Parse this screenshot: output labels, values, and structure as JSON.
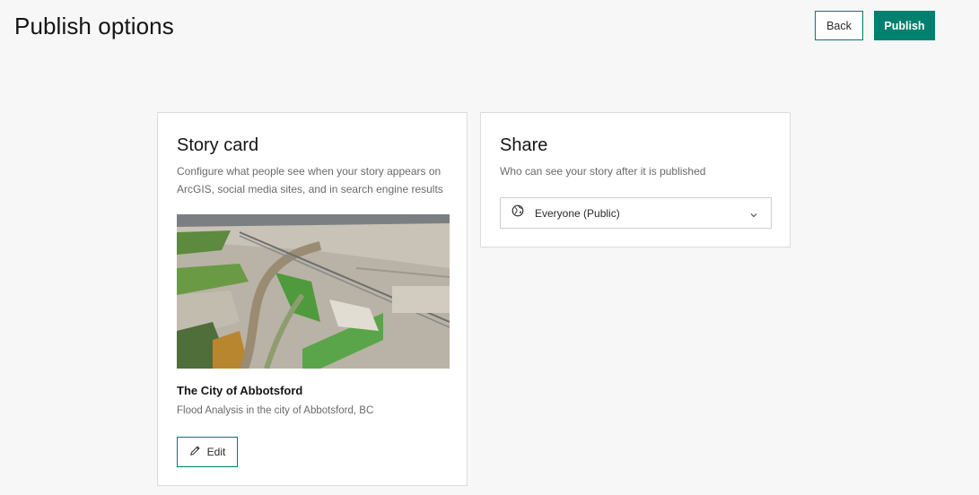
{
  "header": {
    "title": "Publish options",
    "back_label": "Back",
    "publish_label": "Publish"
  },
  "story_card": {
    "title": "Story card",
    "description": "Configure what people see when your story appears on ArcGIS, social media sites, and in search engine results",
    "story_title": "The City of Abbotsford",
    "story_subtitle": "Flood Analysis in the city of Abbotsford, BC",
    "edit_label": "Edit",
    "edit_icon": "pencil-icon"
  },
  "share": {
    "title": "Share",
    "description": "Who can see your story after it is published",
    "selected": "Everyone (Public)",
    "selected_icon": "globe-icon",
    "dropdown_icon": "chevron-down-icon"
  },
  "colors": {
    "accent": "#00806f",
    "background": "#f7f7f7",
    "card": "#ffffff"
  }
}
